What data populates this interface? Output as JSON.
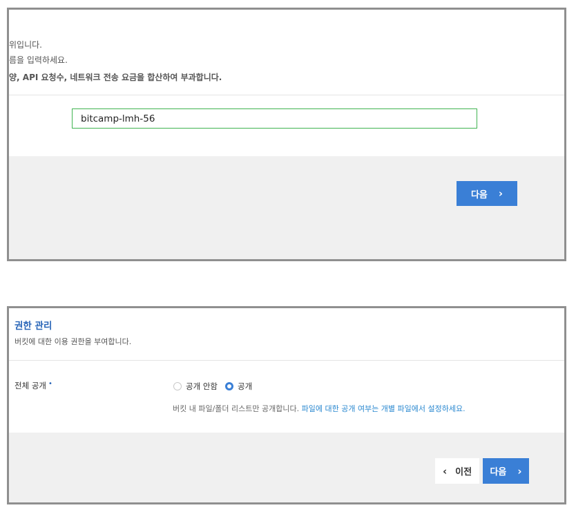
{
  "step_name": {
    "desc_lines": [
      "위입니다.",
      "름을 입력하세요.",
      "양, API 요청수, 네트워크 전송 요금을 합산하여 부과합니다."
    ],
    "bucket_name_value": "bitcamp-lmh-56",
    "next_label": "다음",
    "next_icon": "chevron-right-icon"
  },
  "step_permission": {
    "title": "권한 관리",
    "description": "버킷에 대한 이용 권한을 부여합니다.",
    "public_label": "전체 공개",
    "required_mark": "•",
    "options": [
      {
        "label": "공개 안함",
        "selected": false
      },
      {
        "label": "공개",
        "selected": true
      }
    ],
    "help_plain": "버킷 내 파일/폴더 리스트만 공개합니다.",
    "help_link": "파일에 대한 공개 여부는 개별 파일에서 설정하세요.",
    "prev_label": "이전",
    "next_label": "다음"
  },
  "colors": {
    "accent": "#3a7fd6",
    "input_border_focus": "#3fb34f",
    "title_blue": "#2a66b8",
    "link_blue": "#2a88d0",
    "footer_bg": "#f0f0f0",
    "panel_border": "#8f8f8f"
  }
}
